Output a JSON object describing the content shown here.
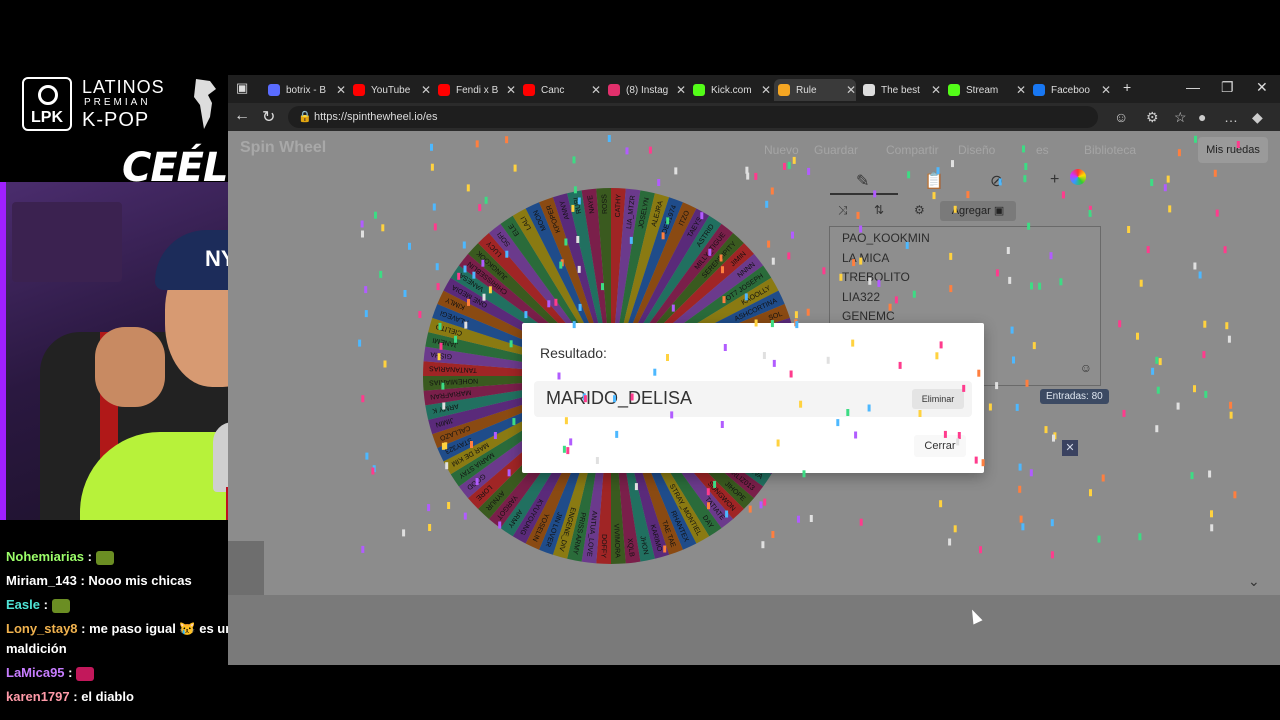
{
  "overlay": {
    "brand_l1": "LATINOS",
    "brand_l2": "PREMIAN",
    "brand_l3": "K-POP",
    "badge": "LPK",
    "streamer": "CEÉLE"
  },
  "webcam": {
    "cap_text": "NY"
  },
  "chat": [
    {
      "user": "Nohemiarias",
      "color": "#9cff6a",
      "message": ""
    },
    {
      "user": "Miriam_143",
      "color": "#ffffff",
      "message": "Nooo mis chicas"
    },
    {
      "user": "Easle",
      "color": "#4fe3d6",
      "message": ""
    },
    {
      "user": "Lony_stay8",
      "color": "#f0b24e",
      "message": "me paso igual 😿 es una maldición"
    },
    {
      "user": "LaMica95",
      "color": "#c77dff",
      "message": ""
    },
    {
      "user": "karen1797",
      "color": "#ff9aa8",
      "message": "el diablo"
    }
  ],
  "browser": {
    "tabs": [
      {
        "label": "botrix - B",
        "fav": "#5a6cff"
      },
      {
        "label": "YouTube",
        "fav": "#ff0000"
      },
      {
        "label": "Fendi x B",
        "fav": "#ff0000"
      },
      {
        "label": "Canc",
        "fav": "#ff0000"
      },
      {
        "label": "(8) Instag",
        "fav": "#e1306c"
      },
      {
        "label": "Kick.com",
        "fav": "#53fc18"
      },
      {
        "label": "Rule",
        "fav": "#f5a623"
      },
      {
        "label": "The best",
        "fav": "#dddddd"
      },
      {
        "label": "Stream",
        "fav": "#53fc18"
      },
      {
        "label": "Faceboo",
        "fav": "#1877f2"
      }
    ],
    "url": "https://spinthewheel.io/es"
  },
  "app": {
    "logo": "Spin Wheel",
    "menu": [
      "Nuevo",
      "Guardar",
      "Compartir",
      "Diseño",
      "es",
      "Biblioteca"
    ],
    "mis_ruedas": "Mis ruedas",
    "agregar": "Agregar",
    "entries": [
      "PAO_KOOKMIN",
      "LA MICA",
      "TREBOLITO",
      "LIA322",
      "GENEMC"
    ],
    "entradas_label": "Entradas: 80",
    "modal": {
      "title": "Resultado:",
      "result": "MARIDO_DELISA",
      "delete": "Eliminar",
      "close": "Cerrar"
    },
    "wheel_labels": [
      "CATHY",
      "LIA_MTZR",
      "JOSELYN",
      "ALEJRA",
      "DEB1974",
      "ITZO",
      "TAEYS",
      "ASTRID",
      "MILLY_TIGUE",
      "SERENDIPITY",
      "JIMIN",
      "NNNN",
      "OT7 JOSEPH",
      "KAOOLLY",
      "ASHCORTINA",
      "SOL",
      "Y200",
      "MARIDO_DELISA",
      "GENEMC",
      "LIA322",
      "TREBOLITO",
      "LA MICA",
      "PAO_KOOKMIN",
      "KAREN WINTER",
      "LEIDIS_04",
      "MARMORE",
      "KAREN",
      "NOVA",
      "KARLIZ013",
      "JIHOPE",
      "SUNGWON",
      "TATIATE",
      "DAY",
      "STRAY_MONTIEL",
      "RHANTEX",
      "TAE TAE",
      "KARIMO",
      "JHON",
      "XQLB",
      "VIVIMORA",
      "DOFFY",
      "ANTUA_LOVE",
      "PRISS ARMY",
      "ENGENE_DIV",
      "JIN LOVER",
      "YOSELIN",
      "KYUYOUNG",
      "ARMY",
      "YARGOT",
      "AYNUR",
      "LORE",
      "GOOD",
      "MARIA STAY",
      "MAR DE KIM",
      "STAY323",
      "CALLAZO",
      "JIMIN",
      "ARMY K",
      "MARIAFRAN",
      "NOHEMIARIAS",
      "TANTANARIAS",
      "GISHA",
      "JANEMI",
      "CIELITO",
      "ALAVEGI",
      "KIMLY",
      "ONE MEDIA",
      "VANESA",
      "CHIRISSEBLIN",
      "JUNGKOOK",
      "LUCY",
      "SOFI",
      "ELE",
      "LALI",
      "MOON",
      "KPOPER",
      "ANNY",
      "RUBI",
      "NAYE",
      "ROSS"
    ]
  }
}
